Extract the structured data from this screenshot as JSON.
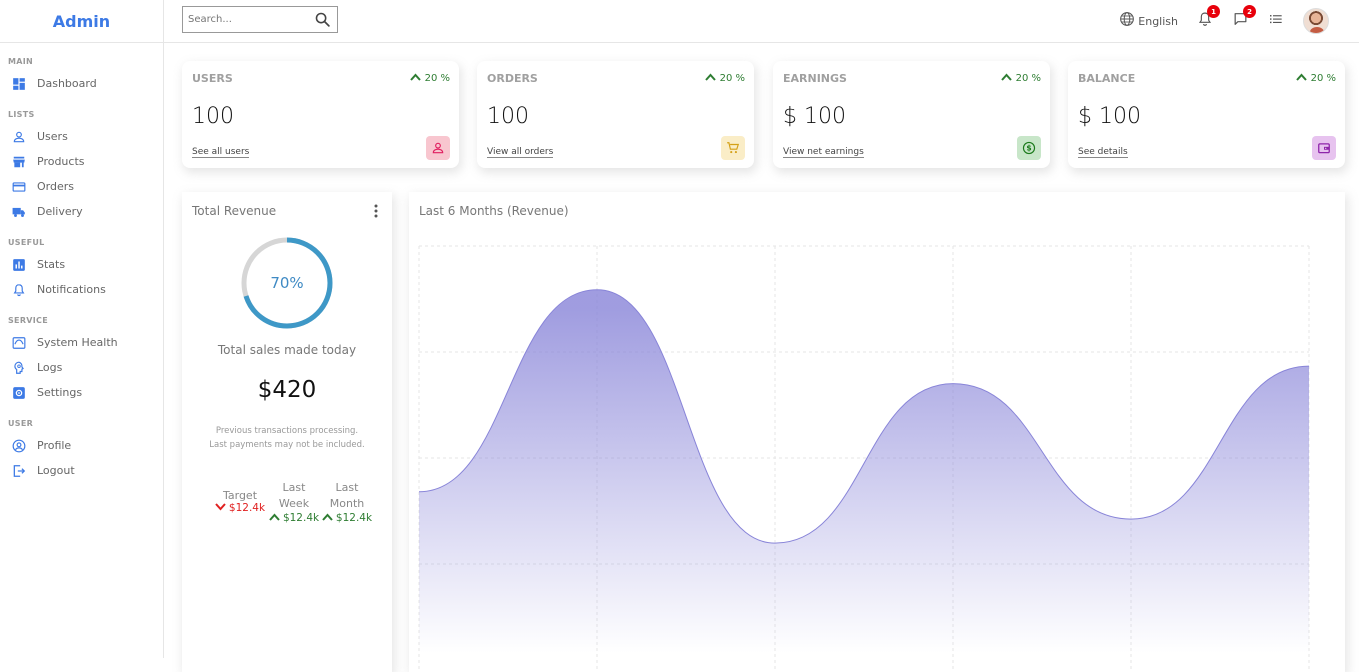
{
  "app": {
    "logo": "Admin"
  },
  "sidebar": {
    "sections": [
      {
        "title": "MAIN",
        "items": [
          {
            "label": "Dashboard",
            "icon": "dashboard-icon"
          }
        ]
      },
      {
        "title": "LISTS",
        "items": [
          {
            "label": "Users",
            "icon": "person-icon"
          },
          {
            "label": "Products",
            "icon": "store-icon"
          },
          {
            "label": "Orders",
            "icon": "credit-card-icon"
          },
          {
            "label": "Delivery",
            "icon": "truck-icon"
          }
        ]
      },
      {
        "title": "USEFUL",
        "items": [
          {
            "label": "Stats",
            "icon": "bar-chart-icon"
          },
          {
            "label": "Notifications",
            "icon": "bell-icon"
          }
        ]
      },
      {
        "title": "SERVICE",
        "items": [
          {
            "label": "System Health",
            "icon": "health-icon"
          },
          {
            "label": "Logs",
            "icon": "psychology-icon"
          },
          {
            "label": "Settings",
            "icon": "settings-icon"
          }
        ]
      },
      {
        "title": "USER",
        "items": [
          {
            "label": "Profile",
            "icon": "account-circle-icon"
          },
          {
            "label": "Logout",
            "icon": "logout-icon"
          }
        ]
      }
    ],
    "accent": "#3d7ae5"
  },
  "topbar": {
    "search_placeholder": "Search...",
    "language": "English",
    "notifications_count": "1",
    "messages_count": "2"
  },
  "widgets": [
    {
      "title": "USERS",
      "counter": "100",
      "link": "See all users",
      "percent": "20 %",
      "icon": "person-icon",
      "icon_color": "#e02060",
      "icon_bg": "#f8c6cf"
    },
    {
      "title": "ORDERS",
      "counter": "100",
      "link": "View all orders",
      "percent": "20 %",
      "icon": "cart-icon",
      "icon_color": "#d4a017",
      "icon_bg": "#faedc7"
    },
    {
      "title": "EARNINGS",
      "counter": "$ 100",
      "link": "View net earnings",
      "percent": "20 %",
      "icon": "dollar-icon",
      "icon_color": "#1b7a1b",
      "icon_bg": "#c8e6c9"
    },
    {
      "title": "BALANCE",
      "counter": "$ 100",
      "link": "See details",
      "percent": "20 %",
      "icon": "wallet-icon",
      "icon_color": "#8e24aa",
      "icon_bg": "#e7c3ef"
    }
  ],
  "featured": {
    "title": "Total Revenue",
    "progress_text": "70%",
    "progress": 0.7,
    "subtitle": "Total sales made today",
    "amount": "$420",
    "description": "Previous transactions processing. Last payments may not be included.",
    "summary": [
      {
        "label": "Target",
        "value": "$12.4k",
        "trend": "down"
      },
      {
        "label": "Last Week",
        "value": "$12.4k",
        "trend": "up"
      },
      {
        "label": "Last Month",
        "value": "$12.4k",
        "trend": "up"
      }
    ]
  },
  "chart": {
    "title": "Last 6 Months (Revenue)"
  },
  "chart_data": {
    "type": "area",
    "title": "Last 6 Months (Revenue)",
    "categories": [
      "",
      "",
      "",
      "",
      "",
      ""
    ],
    "values": [
      1650,
      3500,
      1180,
      2640,
      1400,
      2800
    ],
    "ylim": [
      0,
      3900
    ],
    "grid": true,
    "color": "#8884d8"
  }
}
